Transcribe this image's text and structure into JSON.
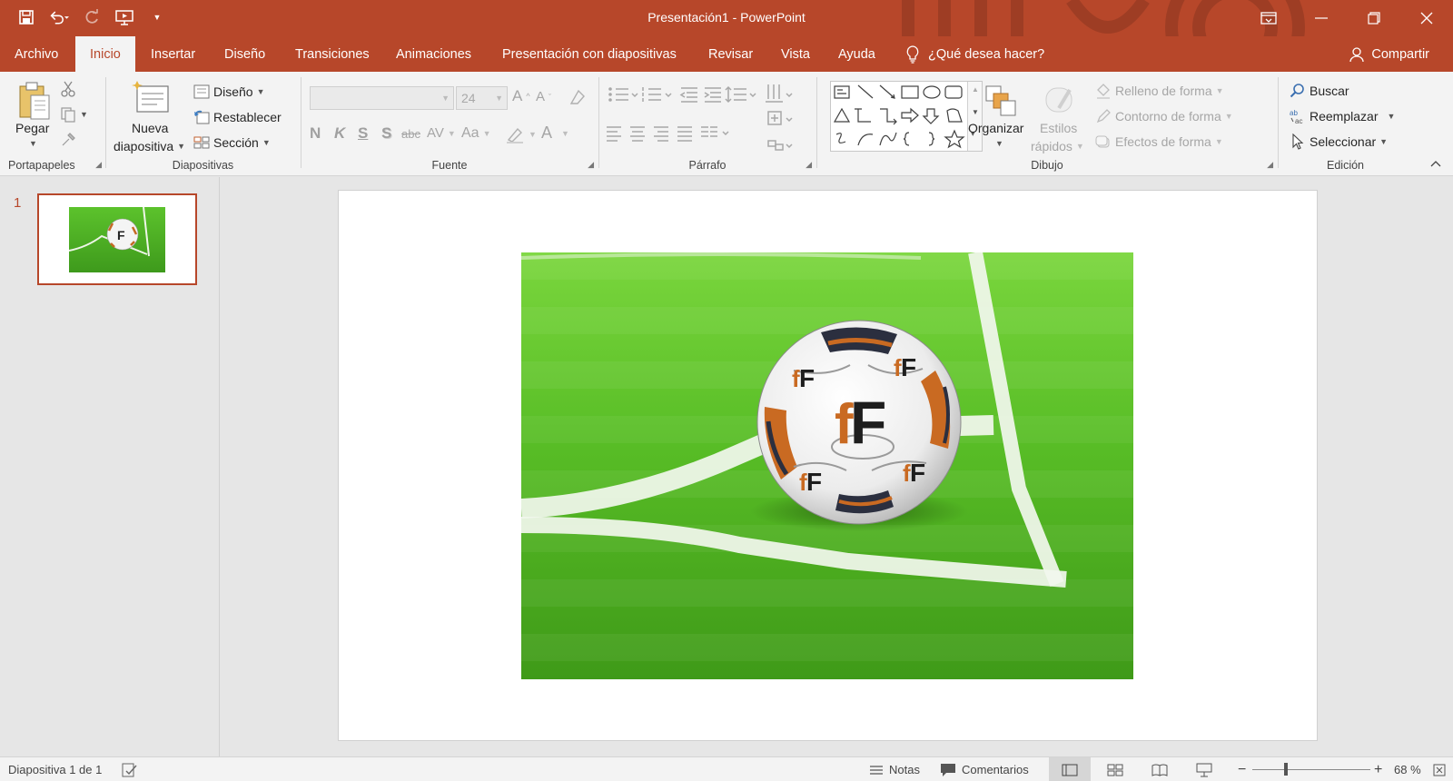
{
  "window": {
    "title": "Presentación1  -  PowerPoint",
    "accent": "#b7472a"
  },
  "tabs": [
    {
      "label": "Archivo"
    },
    {
      "label": "Inicio",
      "active": true
    },
    {
      "label": "Insertar"
    },
    {
      "label": "Diseño"
    },
    {
      "label": "Transiciones"
    },
    {
      "label": "Animaciones"
    },
    {
      "label": "Presentación con diapositivas"
    },
    {
      "label": "Revisar"
    },
    {
      "label": "Vista"
    },
    {
      "label": "Ayuda"
    }
  ],
  "tell_me": "¿Qué desea hacer?",
  "share": "Compartir",
  "ribbon": {
    "portapapeles": {
      "label": "Portapapeles",
      "paste": "Pegar"
    },
    "diapositivas": {
      "label": "Diapositivas",
      "new_slide_1": "Nueva",
      "new_slide_2": "diapositiva",
      "layout": "Diseño",
      "reset": "Restablecer",
      "section": "Sección"
    },
    "fuente": {
      "label": "Fuente",
      "font_size": "24",
      "bold": "N",
      "italic": "K",
      "underline": "S",
      "shadow": "S",
      "strike": "abc",
      "spacing": "AV",
      "case": "Aa"
    },
    "parrafo": {
      "label": "Párrafo"
    },
    "dibujo": {
      "label": "Dibujo",
      "arrange": "Organizar",
      "quick_styles_1": "Estilos",
      "quick_styles_2": "rápidos",
      "fill": "Relleno de forma",
      "outline": "Contorno de forma",
      "effects": "Efectos de forma"
    },
    "edicion": {
      "label": "Edición",
      "find": "Buscar",
      "replace": "Reemplazar",
      "select": "Seleccionar"
    }
  },
  "slides_pane": {
    "number": "1"
  },
  "status": {
    "slide_info": "Diapositiva 1 de 1",
    "notes": "Notas",
    "comments": "Comentarios",
    "zoom": "68 %"
  }
}
